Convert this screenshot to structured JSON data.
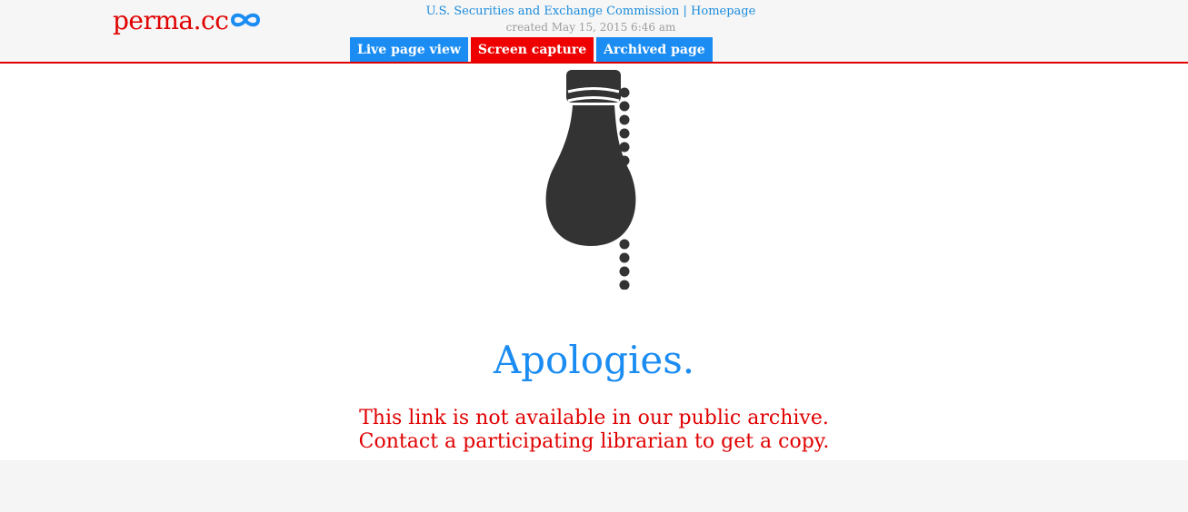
{
  "header": {
    "logo_text": "perma.cc",
    "logo_icon": "infinity-icon",
    "title": "U.S. Securities and Exchange Commission | Homepage",
    "created": "created May 15, 2015 6:46 am",
    "tabs": [
      {
        "label": "Live page view",
        "color": "#1a8cf2"
      },
      {
        "label": "Screen capture",
        "color": "#ee0000"
      },
      {
        "label": "Archived page",
        "color": "#1a8cf2"
      }
    ]
  },
  "main": {
    "illustration_icon": "lightbulb-icon",
    "heading": "Apologies.",
    "message_line1": "This link is not available in our public archive.",
    "message_line2": "Contact a participating librarian to get a copy."
  },
  "colors": {
    "brand_red": "#e00000",
    "accent_blue": "#1a8cf2",
    "muted_gray": "#9c9c9c",
    "icon_dark": "#333333"
  }
}
